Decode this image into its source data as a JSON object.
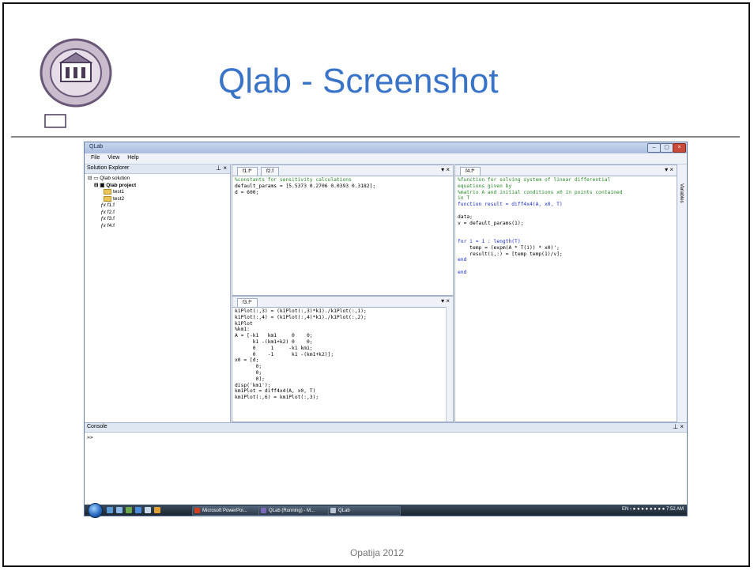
{
  "slide": {
    "title": "Qlab - Screenshot",
    "footer": "Opatija 2012"
  },
  "window": {
    "title": "QLab",
    "menu": [
      "File",
      "View",
      "Help"
    ],
    "controls": [
      "minimize",
      "maximize",
      "close"
    ]
  },
  "explorer": {
    "title": "Solution Explorer",
    "controls": "\u0004 ×",
    "tree": {
      "solution": "Qlab solution",
      "project": "Qlab project",
      "folders": [
        "test1",
        "test2"
      ],
      "files": [
        "f1.f",
        "f2.f",
        "f3.f",
        "f4.f"
      ]
    }
  },
  "editor_top_left": {
    "tabs": [
      "f1.f*",
      "f2.f"
    ],
    "active_tab": 0,
    "lines": [
      {
        "t": "%constants for sensitivity calculations",
        "cls": "c"
      },
      {
        "t": "default_params = [5.5373 0.2706 0.0393 0.3182];",
        "cls": ""
      },
      {
        "t": "d = 600;",
        "cls": ""
      }
    ]
  },
  "editor_bottom": {
    "tabs": [
      "f3.f*"
    ],
    "active_tab": 0,
    "lines": [
      "k1Plot(:,3) = (k1Plot(:,3)*k1)./k1Plot(:,1);",
      "k1Plot(:,4) = (k1Plot(:,4)*k1)./k1Plot(:,2);",
      "k1Plot",
      "%km1:",
      "A = [-k1   km1     0    0;",
      "      k1 -(km1+k2) 0    0;",
      "      0     1     -k1 km1;",
      "      0    -1      k1 -(km1+k2)];",
      "x0 = [d;",
      "       0;",
      "       0;",
      "       0];",
      "disp('km1');",
      "km1Plot = diff4x4(A, x0, T)",
      "km1Plot(:,6) = km1Plot(:,3);"
    ]
  },
  "editor_right": {
    "tabs": [
      "f4.f*"
    ],
    "active_tab": 0,
    "lines": [
      {
        "t": "%function for solving system of linear differential",
        "cls": "c"
      },
      {
        "t": "equations given by",
        "cls": "c"
      },
      {
        "t": "%matrix A and initial conditions x0 in points contained",
        "cls": "c"
      },
      {
        "t": "in T",
        "cls": "c"
      },
      {
        "t": "function result = diff4x4(A, x0, T)",
        "cls": "k"
      },
      {
        "t": "",
        "cls": ""
      },
      {
        "t": "data;",
        "cls": ""
      },
      {
        "t": "v = default_params(1);",
        "cls": ""
      },
      {
        "t": "",
        "cls": ""
      },
      {
        "t": "",
        "cls": ""
      },
      {
        "t": "for i = 1 : length(T)",
        "cls": "k"
      },
      {
        "t": "    temp = (expm(A * T(i)) * x0)';",
        "cls": ""
      },
      {
        "t": "    result(i,:) = [temp temp(1)/v];",
        "cls": ""
      },
      {
        "t": "end",
        "cls": "k"
      },
      {
        "t": "",
        "cls": ""
      },
      {
        "t": "end",
        "cls": "k"
      }
    ]
  },
  "variables_tab": "Variables",
  "console": {
    "title": "Console",
    "prompt": ">>"
  },
  "taskbar": {
    "buttons": [
      "Microsoft PowerPoi...",
      "QLab (Running) - M...",
      "QLab"
    ],
    "language": "EN",
    "time": "7:52 AM"
  }
}
